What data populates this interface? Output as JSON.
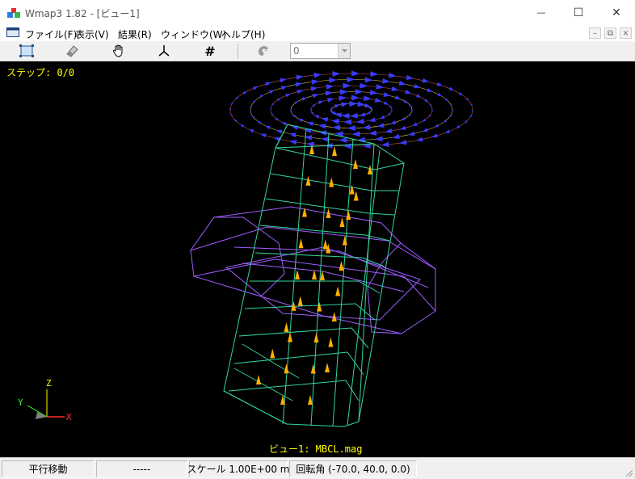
{
  "window": {
    "title": "Wmap3 1.82 - [ビュー1]",
    "minimize_glyph": "—",
    "maximize_glyph": "☐",
    "close_glyph": "✕"
  },
  "menu": {
    "items": [
      "ファイル(F)",
      "表示(V)",
      "結果(R)",
      "ウィンドウ(W)",
      "ヘルプ(H)"
    ],
    "mdi_minimize": "–",
    "mdi_restore": "⧉",
    "mdi_close": "×"
  },
  "toolbar": {
    "icons": [
      "fit-view-icon",
      "eraser-icon",
      "hand-pan-icon",
      "axes-icon",
      "grid-hash-icon",
      "rotate-disabled-icon"
    ],
    "hash_glyph": "#",
    "step_value": "0"
  },
  "viewport": {
    "step_label": "ステップ: 0/0",
    "caption": "ビュー1: MBCL.mag",
    "axes": {
      "x": "X",
      "y": "Y",
      "z": "Z"
    },
    "colors": {
      "background": "#000000",
      "column_mesh": "#33d6a0",
      "ring_mesh": "#a05cff",
      "field_arrows": "#ffb000",
      "disk_arrows": "#3a3aff",
      "label_text": "#ffff00"
    }
  },
  "status": {
    "mode": "平行移動",
    "info": "-----",
    "scale": "スケール 1.00E+00 m",
    "rotation": "回転角 (-70.0, 40.0, 0.0)"
  }
}
